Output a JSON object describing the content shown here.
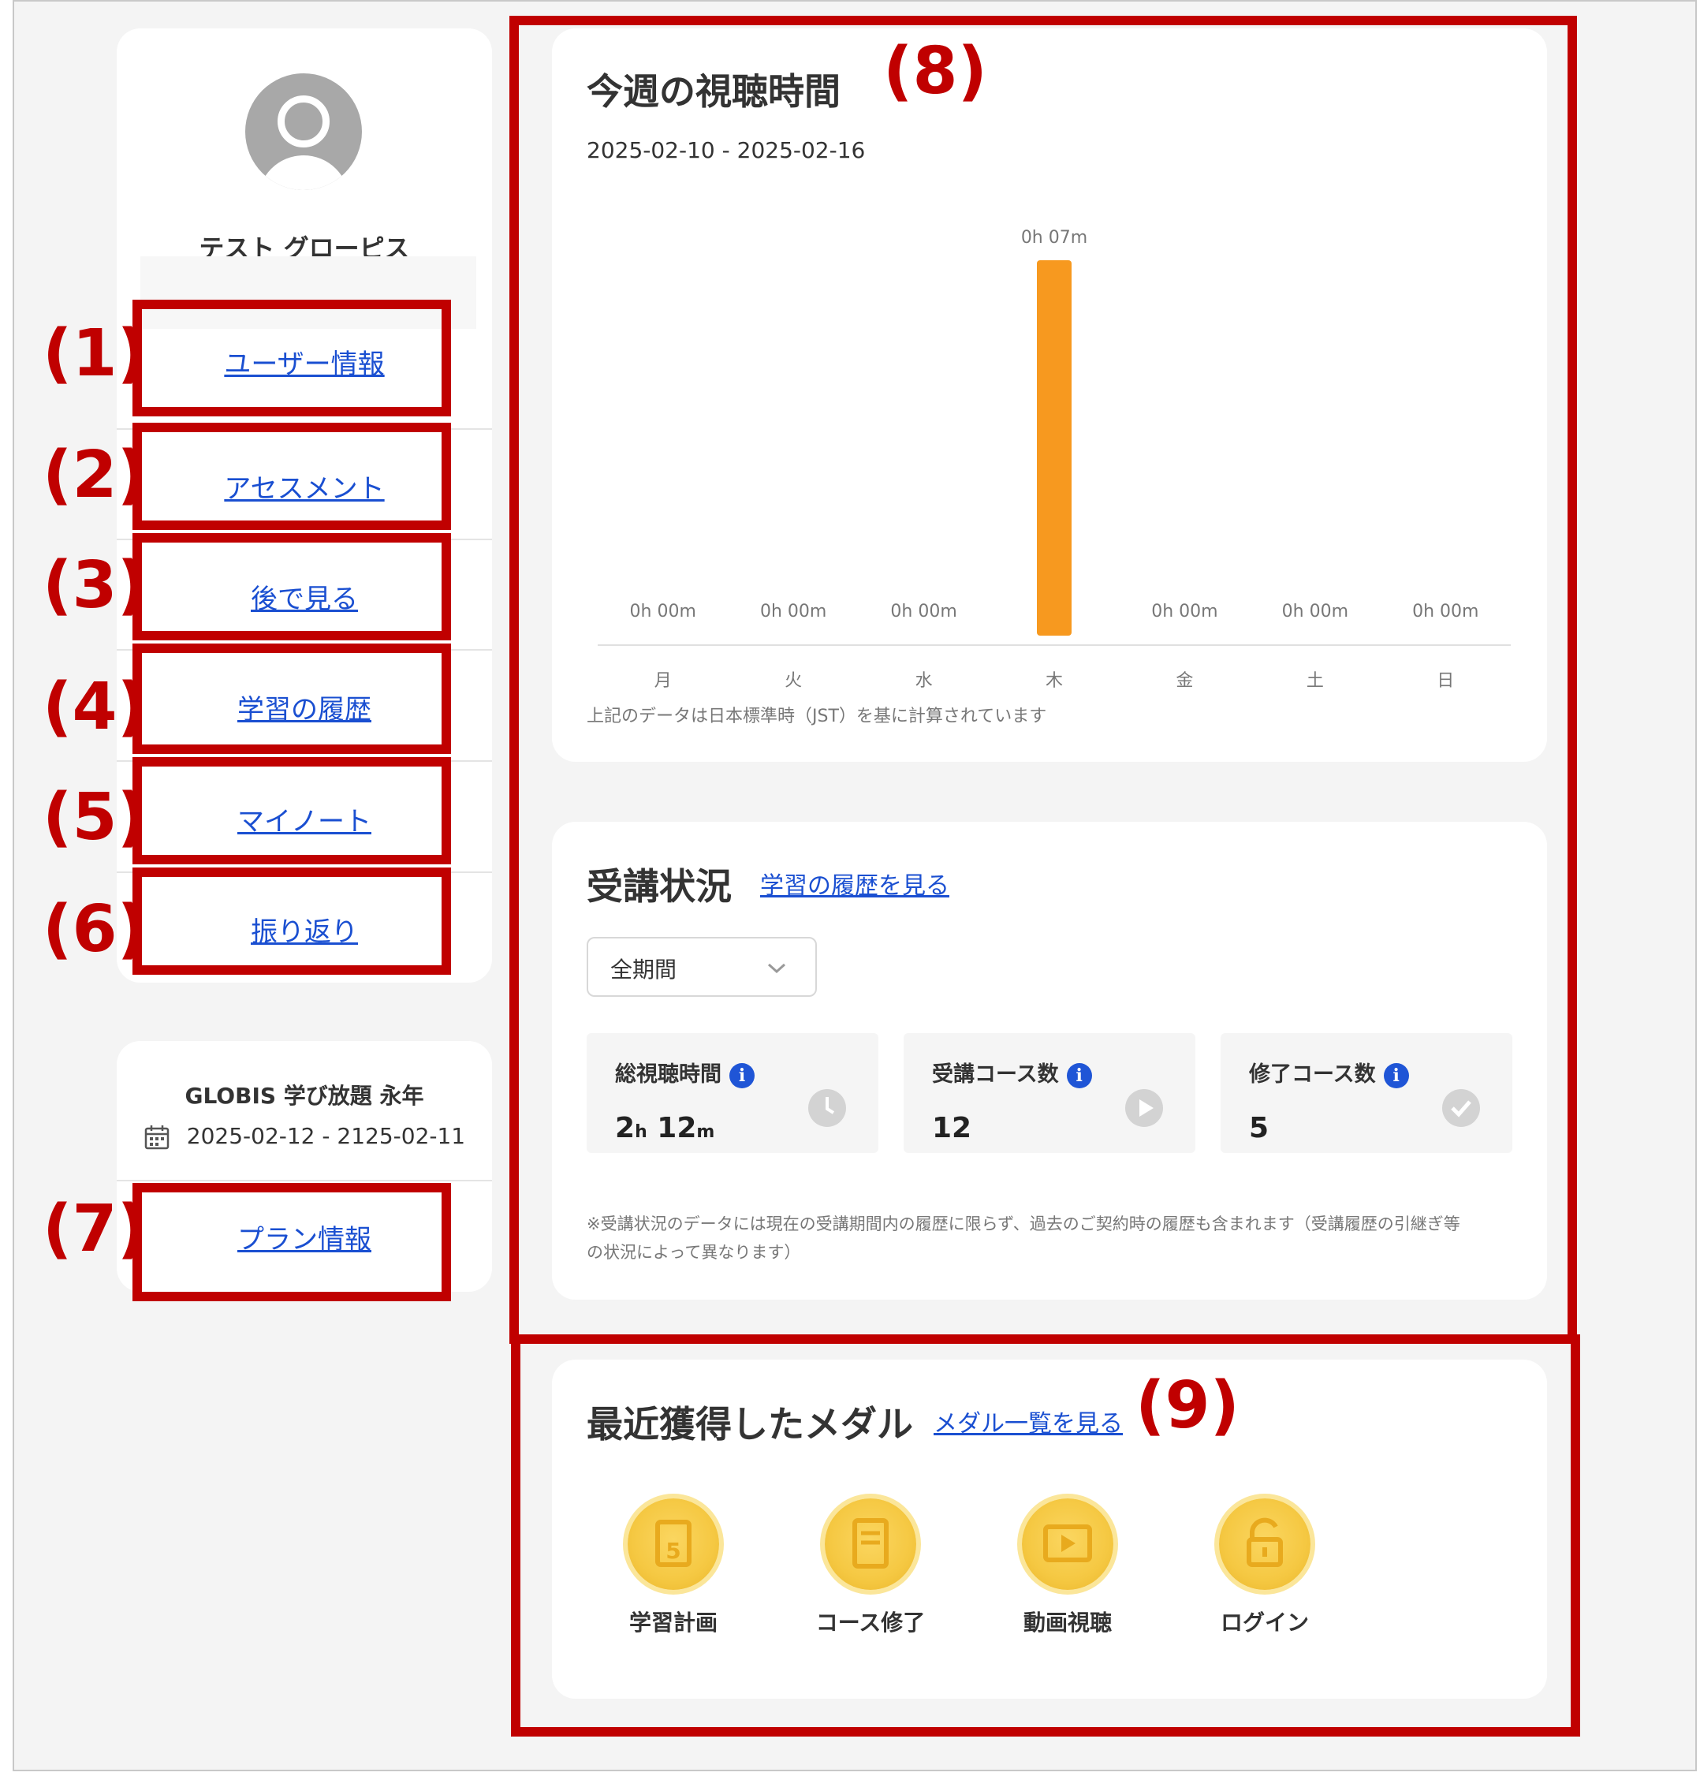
{
  "user": {
    "name": "テスト グローピス"
  },
  "menu": {
    "items": [
      {
        "label": "ユーザー情報"
      },
      {
        "label": "アセスメント"
      },
      {
        "label": "後で見る"
      },
      {
        "label": "学習の履歴"
      },
      {
        "label": "マイノート"
      },
      {
        "label": "振り返り"
      }
    ]
  },
  "plan": {
    "name": "GLOBIS 学び放題 永年",
    "period": "2025-02-12 - 2125-02-11",
    "link": "プラン情報"
  },
  "markers": [
    "(1)",
    "(2)",
    "(3)",
    "(4)",
    "(5)",
    "(6)",
    "(7)",
    "(8)",
    "(9)"
  ],
  "weekly": {
    "title": "今週の視聴時間",
    "range": "2025-02-10 - 2025-02-16",
    "note": "上記のデータは日本標準時（JST）を基に計算されています"
  },
  "chart_data": {
    "type": "bar",
    "categories": [
      "月",
      "火",
      "水",
      "木",
      "金",
      "土",
      "日"
    ],
    "values": [
      0,
      0,
      0,
      7
    ],
    "value_labels": [
      "0h 00m",
      "0h 00m",
      "0h 00m",
      "0h 07m",
      "0h 00m",
      "0h 00m",
      "0h 00m"
    ],
    "unit": "minutes",
    "ylim": [
      0,
      7
    ],
    "bar_color": "#f7991f",
    "grid": false
  },
  "status": {
    "title": "受講状況",
    "history_link": "学習の履歴を見る",
    "period_select": "全期間",
    "stats": [
      {
        "label": "総視聴時間",
        "value": "2h 12m",
        "icon": "clock-icon"
      },
      {
        "label": "受講コース数",
        "value": "12",
        "icon": "play-icon"
      },
      {
        "label": "修了コース数",
        "value": "5",
        "icon": "check-icon"
      }
    ],
    "note_line1": "※受講状況のデータには現在の受講期間内の履歴に限らず、過去のご契約時の履歴も含まれます（受講履歴の引継ぎ等",
    "note_line2": "の状況によって異なります）"
  },
  "medals": {
    "title": "最近獲得したメダル",
    "list_link": "メダル一覧を見る",
    "items": [
      {
        "label": "学習計画",
        "icon": "calendar-medal-icon"
      },
      {
        "label": "コース修了",
        "icon": "book-medal-icon"
      },
      {
        "label": "動画視聴",
        "icon": "video-medal-icon"
      },
      {
        "label": "ログイン",
        "icon": "unlock-medal-icon"
      }
    ]
  },
  "colors": {
    "accent": "#1a4fd1",
    "annotation": "#c00000",
    "bar": "#f7991f",
    "medal": "#f5c842"
  }
}
